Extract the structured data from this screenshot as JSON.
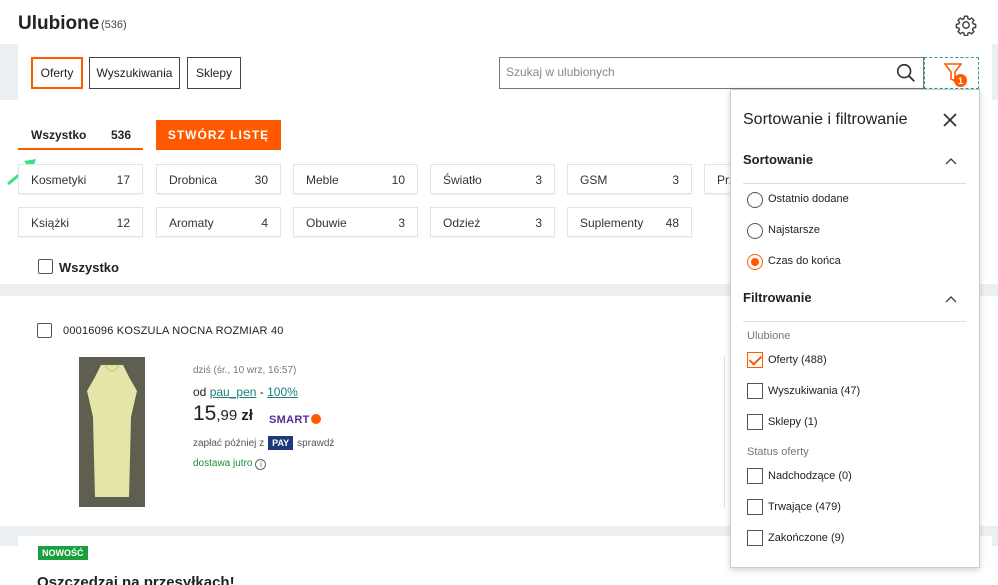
{
  "header": {
    "title": "Ulubione",
    "count": "(536)",
    "settings_icon": "gear-icon"
  },
  "toolbar": {
    "tabs": [
      {
        "label": "Oferty",
        "active": true
      },
      {
        "label": "Wyszukiwania",
        "active": false
      },
      {
        "label": "Sklepy",
        "active": false
      }
    ],
    "search_placeholder": "Szukaj w ulubionych",
    "filter_badge": "1"
  },
  "lists": {
    "all_label": "Wszystko",
    "all_count": "536",
    "create_label": "STWÓRZ LISTĘ"
  },
  "categories": [
    {
      "label": "Kosmetyki",
      "count": "17"
    },
    {
      "label": "Drobnica",
      "count": "30"
    },
    {
      "label": "Meble",
      "count": "10"
    },
    {
      "label": "Światło",
      "count": "3"
    },
    {
      "label": "GSM",
      "count": "3"
    },
    {
      "label": "Prz",
      "count": ""
    },
    {
      "label": "Książki",
      "count": "12"
    },
    {
      "label": "Aromaty",
      "count": "4"
    },
    {
      "label": "Obuwie",
      "count": "3"
    },
    {
      "label": "Odzież",
      "count": "3"
    },
    {
      "label": "Suplementy",
      "count": "48"
    }
  ],
  "select_all_label": "Wszystko",
  "listing": {
    "title": "00016096 KOSZULA NOCNA ROZMIAR 40",
    "date": "dziś (śr., 10 wrz, 16:57)",
    "seller_prefix": "od",
    "seller_name": "pau_pen",
    "seller_sep": " - ",
    "seller_rating": "100%",
    "price_int": "15",
    "price_cents": ",99",
    "currency": "zł",
    "smart_label": "SMART",
    "paylater_prefix": "zapłać później z",
    "pay_label": "PAY",
    "paylater_suffix": "sprawdź",
    "delivery": "dostawa jutro",
    "info_glyph": "i"
  },
  "footer": {
    "badge": "NOWOŚĆ",
    "title": "Oszczędzaj na przesyłkach!"
  },
  "panel": {
    "title": "Sortowanie i filtrowanie",
    "sorting_label": "Sortowanie",
    "sort_options": [
      {
        "label": "Ostatnio dodane",
        "selected": false
      },
      {
        "label": "Najstarsze",
        "selected": false
      },
      {
        "label": "Czas do końca",
        "selected": true
      }
    ],
    "filtering_label": "Filtrowanie",
    "favorites_group": "Ulubione",
    "favorites_options": [
      {
        "label": "Oferty (488)",
        "checked": true
      },
      {
        "label": "Wyszukiwania (47)",
        "checked": false
      },
      {
        "label": "Sklepy (1)",
        "checked": false
      }
    ],
    "status_group": "Status oferty",
    "status_options": [
      {
        "label": "Nadchodzące (0)",
        "checked": false
      },
      {
        "label": "Trwające (479)",
        "checked": false
      },
      {
        "label": "Zakończone (9)",
        "checked": false
      }
    ]
  },
  "colors": {
    "accent": "#ff5a00",
    "teal": "#1a7f7b",
    "green": "#1b8e3a"
  }
}
